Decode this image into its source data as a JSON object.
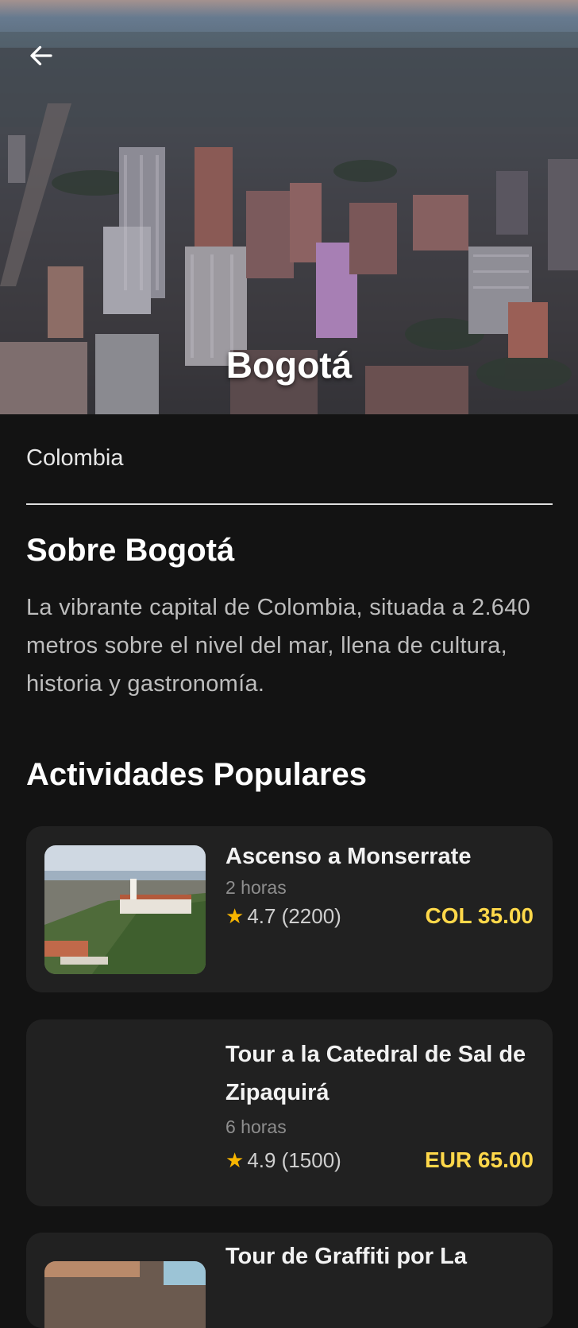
{
  "city": {
    "name": "Bogotá",
    "country": "Colombia"
  },
  "about": {
    "title": "Sobre Bogotá",
    "text": "La vibrante capital de Colombia, situada a 2.640 metros sobre el nivel del mar, llena de cultura, historia y gastronomía."
  },
  "activities": {
    "title": "Actividades Populares",
    "items": [
      {
        "name": "Ascenso a Monserrate",
        "duration": "2 horas",
        "rating": "4.7 (2200)",
        "price": "COL 35.00"
      },
      {
        "name": "Tour a la Catedral de Sal de Zipaquirá",
        "duration": "6 horas",
        "rating": "4.9 (1500)",
        "price": "EUR 65.00"
      },
      {
        "name": "Tour de Graffiti por La",
        "duration": "",
        "rating": "",
        "price": ""
      }
    ]
  },
  "icons": {
    "back": "arrow-left-icon",
    "star": "star-icon"
  },
  "colors": {
    "background": "#131313",
    "card": "#212121",
    "price": "#ffd84a",
    "star": "#f7b500"
  }
}
